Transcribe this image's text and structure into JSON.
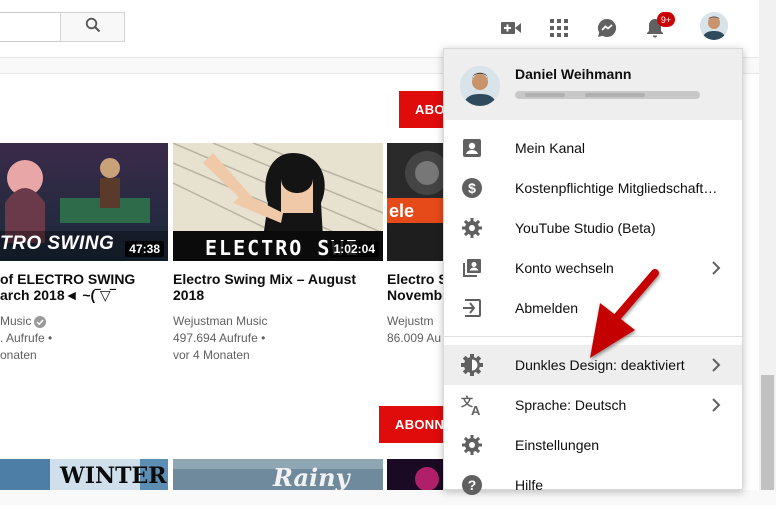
{
  "header": {
    "notification_count": "9+"
  },
  "section1": {
    "subscribe_label": "ABONNIEREN",
    "videos": [
      {
        "title_line1": "of ELECTRO SWING",
        "title_line2": "arch 2018◄ ~(‾▽‾",
        "channel": "Music",
        "views": ". Aufrufe •",
        "age": "onaten",
        "duration": "47:38",
        "thumb_text": "TRO SWING"
      },
      {
        "title_line1": "Electro Swing Mix – August",
        "title_line2": "2018",
        "channel": "Wejustman Music",
        "views": "497.694 Aufrufe •",
        "age": "vor 4 Monaten",
        "duration": "1:02:04",
        "thumb_text": "ELECTRO SWI"
      },
      {
        "title_line1": "Electro S",
        "title_line2": "Novembe",
        "channel": "Wejustm",
        "views": "86.009 Au",
        "age": "",
        "duration": "",
        "thumb_text": "ele"
      }
    ]
  },
  "section2": {
    "subscribe_label": "ABONNIEREN",
    "thumbs": [
      {
        "text": "WINTER"
      },
      {
        "text": "Rainy"
      },
      {
        "text": ""
      }
    ]
  },
  "menu": {
    "user_name": "Daniel Weihmann",
    "items": [
      {
        "label": "Mein Kanal",
        "icon": "account-box-icon"
      },
      {
        "label": "Kostenpflichtige Mitgliedschaft…",
        "icon": "dollar-icon"
      },
      {
        "label": "YouTube Studio (Beta)",
        "icon": "gear-icon"
      },
      {
        "label": "Konto wechseln",
        "icon": "switch-account-icon"
      },
      {
        "label": "Abmelden",
        "icon": "sign-out-icon"
      },
      {
        "label": "Dunkles Design: deaktiviert",
        "icon": "dark-theme-icon"
      },
      {
        "label": "Sprache: Deutsch",
        "icon": "translate-icon"
      },
      {
        "label": "Einstellungen",
        "icon": "gear-icon"
      },
      {
        "label": "Hilfe",
        "icon": "help-icon"
      }
    ]
  },
  "colors": {
    "brand_red": "#e00b0b",
    "annotation_arrow": "#c40000"
  }
}
